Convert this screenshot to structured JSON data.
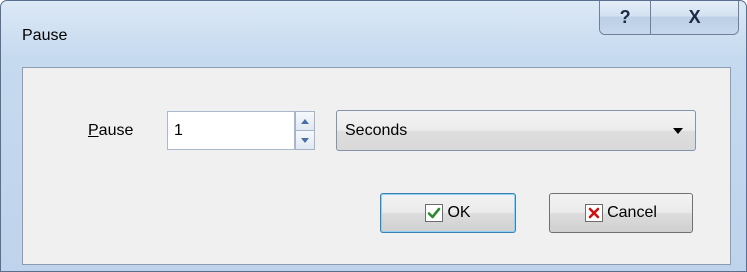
{
  "window": {
    "title": "Pause",
    "help_glyph": "?",
    "close_glyph": "X"
  },
  "form": {
    "pause_label_accel": "P",
    "pause_label_rest": "ause",
    "pause_value": "1",
    "unit_selected": "Seconds"
  },
  "buttons": {
    "ok_label": "OK",
    "cancel_label": "Cancel"
  },
  "icons": {
    "ok_icon": "checkmark-icon",
    "cancel_icon": "x-mark-icon",
    "spin_up": "spin-up-icon",
    "spin_down": "spin-down-icon",
    "dropdown": "chevron-down-icon"
  },
  "colors": {
    "check_green": "#2e8b2e",
    "cancel_red": "#d01010"
  }
}
